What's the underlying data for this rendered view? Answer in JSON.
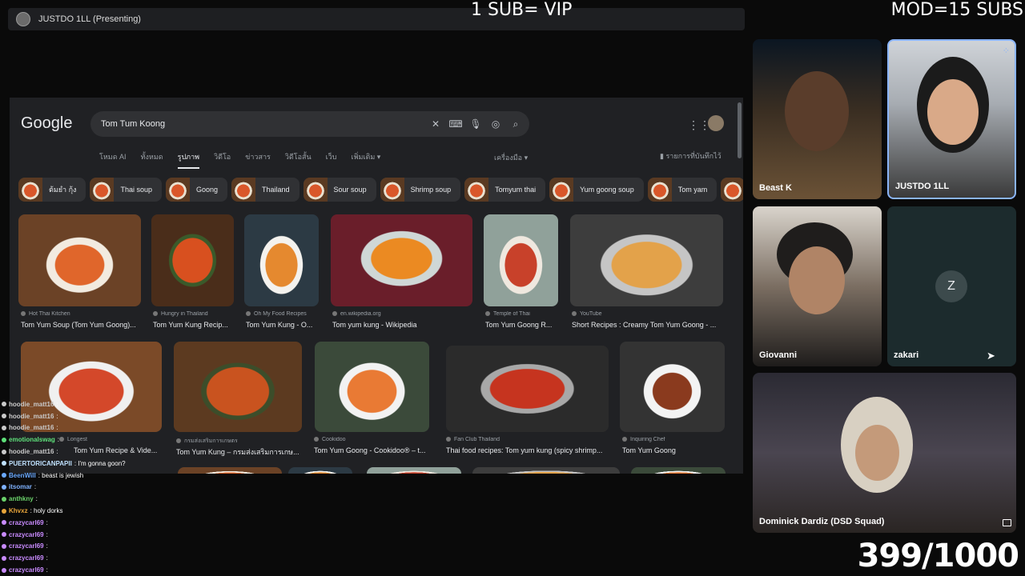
{
  "meet": {
    "presenting_label": "JUSTDO 1LL (Presenting)"
  },
  "overlay": {
    "vip_text": "1 SUB= VIP",
    "mod_text": "MOD=15 SUBS",
    "counter": "399/1000"
  },
  "google": {
    "logo": "Google",
    "query": "Tom Tum Koong",
    "icons": [
      "close-icon",
      "keyboard-icon",
      "mic-icon",
      "lens-icon",
      "search-icon"
    ],
    "tabs": [
      "โหมด AI",
      "ทั้งหมด",
      "รูปภาพ",
      "วิดีโอ",
      "ข่าวสาร",
      "วิดีโอสั้น",
      "เว็บ",
      "เพิ่มเติม ▾"
    ],
    "active_tab": "รูปภาพ",
    "tools_label": "เครื่องมือ ▾",
    "saved_label": "รายการที่บันทึกไว้",
    "chips": [
      "ต้มยำ กุ้ง",
      "Thai soup",
      "Goong",
      "Thailand",
      "Sour soup",
      "Shrimp soup",
      "Tomyum thai",
      "Yum goong soup",
      "Tom yam"
    ],
    "row1": [
      {
        "source": "Hot Thai Kitchen",
        "caption": "Tom Yum Soup (Tom Yum Goong)..."
      },
      {
        "source": "Hungry in Thailand",
        "caption": "Tom Yum Kung Recip..."
      },
      {
        "source": "Oh My Food Recipes",
        "caption": "Tom Yum Kung - O..."
      },
      {
        "source": "en.wikipedia.org",
        "caption": "Tom yum kung - Wikipedia"
      },
      {
        "source": "Temple of Thai",
        "caption": "Tom Yum Goong R..."
      },
      {
        "source": "YouTube",
        "caption": "Short Recipes : Creamy Tom Yum Goong - ..."
      }
    ],
    "row2": [
      {
        "source": "Longest",
        "caption": "Tom Yum Recipe & Vide..."
      },
      {
        "source": "กรมส่งเสริมการเกษตร",
        "caption": "Tom Yum Kung – กรมส่งเสริมการเกษ..."
      },
      {
        "source": "Cookidoo",
        "caption": "Tom Yum Goong - Cookidoo® – t..."
      },
      {
        "source": "Fan Club Thailand",
        "caption": "Thai food recipes: Tom yum kung (spicy shrimp..."
      },
      {
        "source": "Inquiring Chef",
        "caption": "Tom Yum Goong"
      }
    ]
  },
  "participants": [
    {
      "name": "Beast K"
    },
    {
      "name": "JUSTDO 1LL"
    },
    {
      "name": "Giovanni"
    },
    {
      "name": "zakari",
      "avatar_letter": "Z"
    },
    {
      "name": "Dominick Dardiz (DSD Squad)"
    }
  ],
  "chat": [
    {
      "user": "hoodie_matt16",
      "msg": ":",
      "color": "#c9c9c9"
    },
    {
      "user": "hoodie_matt16",
      "msg": ":",
      "color": "#c9c9c9"
    },
    {
      "user": "hoodie_matt16",
      "msg": ":",
      "color": "#c9c9c9"
    },
    {
      "user": "emotionalswag",
      "msg": ":",
      "color": "#5ee07a"
    },
    {
      "user": "hoodie_matt16",
      "msg": ":",
      "color": "#c9c9c9"
    },
    {
      "user": "PUERTORICANPAPII",
      "msg": ": I'm gonna goon?",
      "color": "#bfe1ff"
    },
    {
      "user": "BeenWill",
      "msg": ": beast is jewish",
      "color": "#6aa9ff"
    },
    {
      "user": "itsomar",
      "msg": ":",
      "color": "#7fb2ff"
    },
    {
      "user": "anthkny",
      "msg": ":",
      "color": "#6bd36b"
    },
    {
      "user": "Khvxz",
      "msg": ": holy dorks",
      "color": "#e8a53a"
    },
    {
      "user": "crazycarl69",
      "msg": ":",
      "color": "#c98bff"
    },
    {
      "user": "crazycarl69",
      "msg": ":",
      "color": "#c98bff"
    },
    {
      "user": "crazycarl69",
      "msg": ":",
      "color": "#c98bff"
    },
    {
      "user": "crazycarl69",
      "msg": ":",
      "color": "#c98bff"
    },
    {
      "user": "crazycarl69",
      "msg": ":",
      "color": "#c98bff"
    }
  ]
}
